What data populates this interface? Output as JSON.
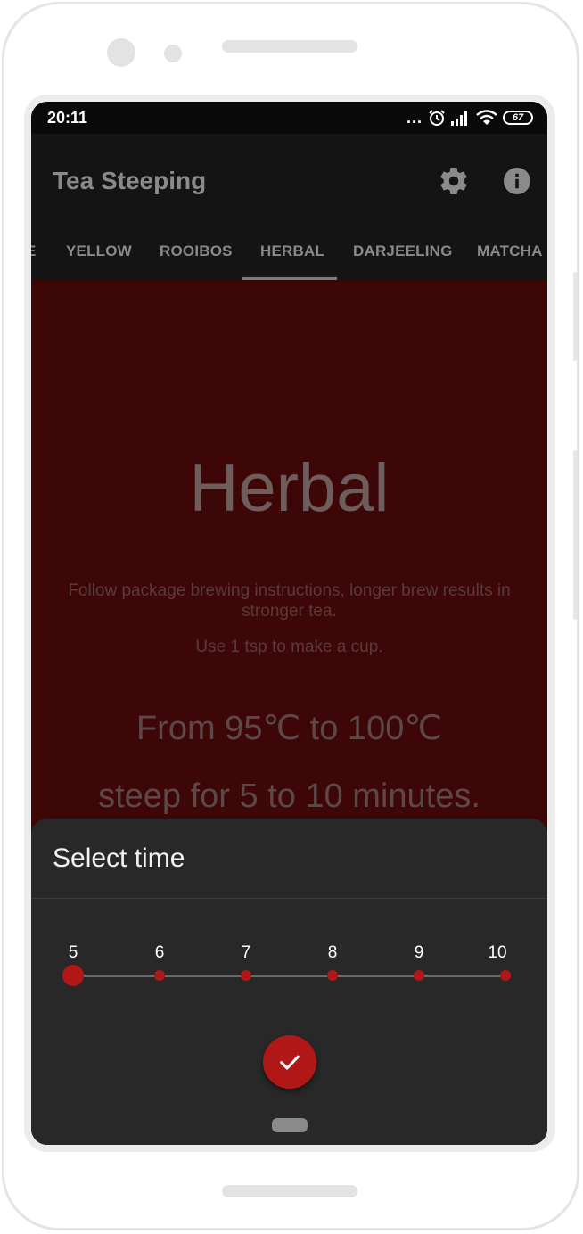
{
  "status_bar": {
    "time": "20:11",
    "more_dots": "...",
    "battery": "67",
    "icons": [
      "alarm-icon",
      "signal-icon",
      "wifi-icon",
      "battery-icon"
    ]
  },
  "app_bar": {
    "title": "Tea Steeping",
    "actions": [
      "gear-icon",
      "info-icon"
    ]
  },
  "tabs": {
    "items": [
      {
        "label": "E"
      },
      {
        "label": "YELLOW"
      },
      {
        "label": "ROOIBOS"
      },
      {
        "label": "HERBAL",
        "selected": true
      },
      {
        "label": "DARJEELING"
      },
      {
        "label": "MATCHA"
      }
    ]
  },
  "tea": {
    "name": "Herbal",
    "description": "Follow package brewing instructions, longer brew results in stronger tea.",
    "amount": "Use 1 tsp to make a cup.",
    "temperature": "From 95℃ to 100℃",
    "steep_time": "steep for 5 to 10 minutes."
  },
  "time_sheet": {
    "title": "Select time",
    "slider": {
      "ticks": [
        "5",
        "6",
        "7",
        "8",
        "9",
        "10"
      ],
      "selected_value": 5
    },
    "confirm_icon": "check-icon"
  },
  "colors": {
    "accent": "#b01818",
    "content_background": "#3e0707",
    "sheet_background": "#282828",
    "toolbar_background": "#141414"
  }
}
